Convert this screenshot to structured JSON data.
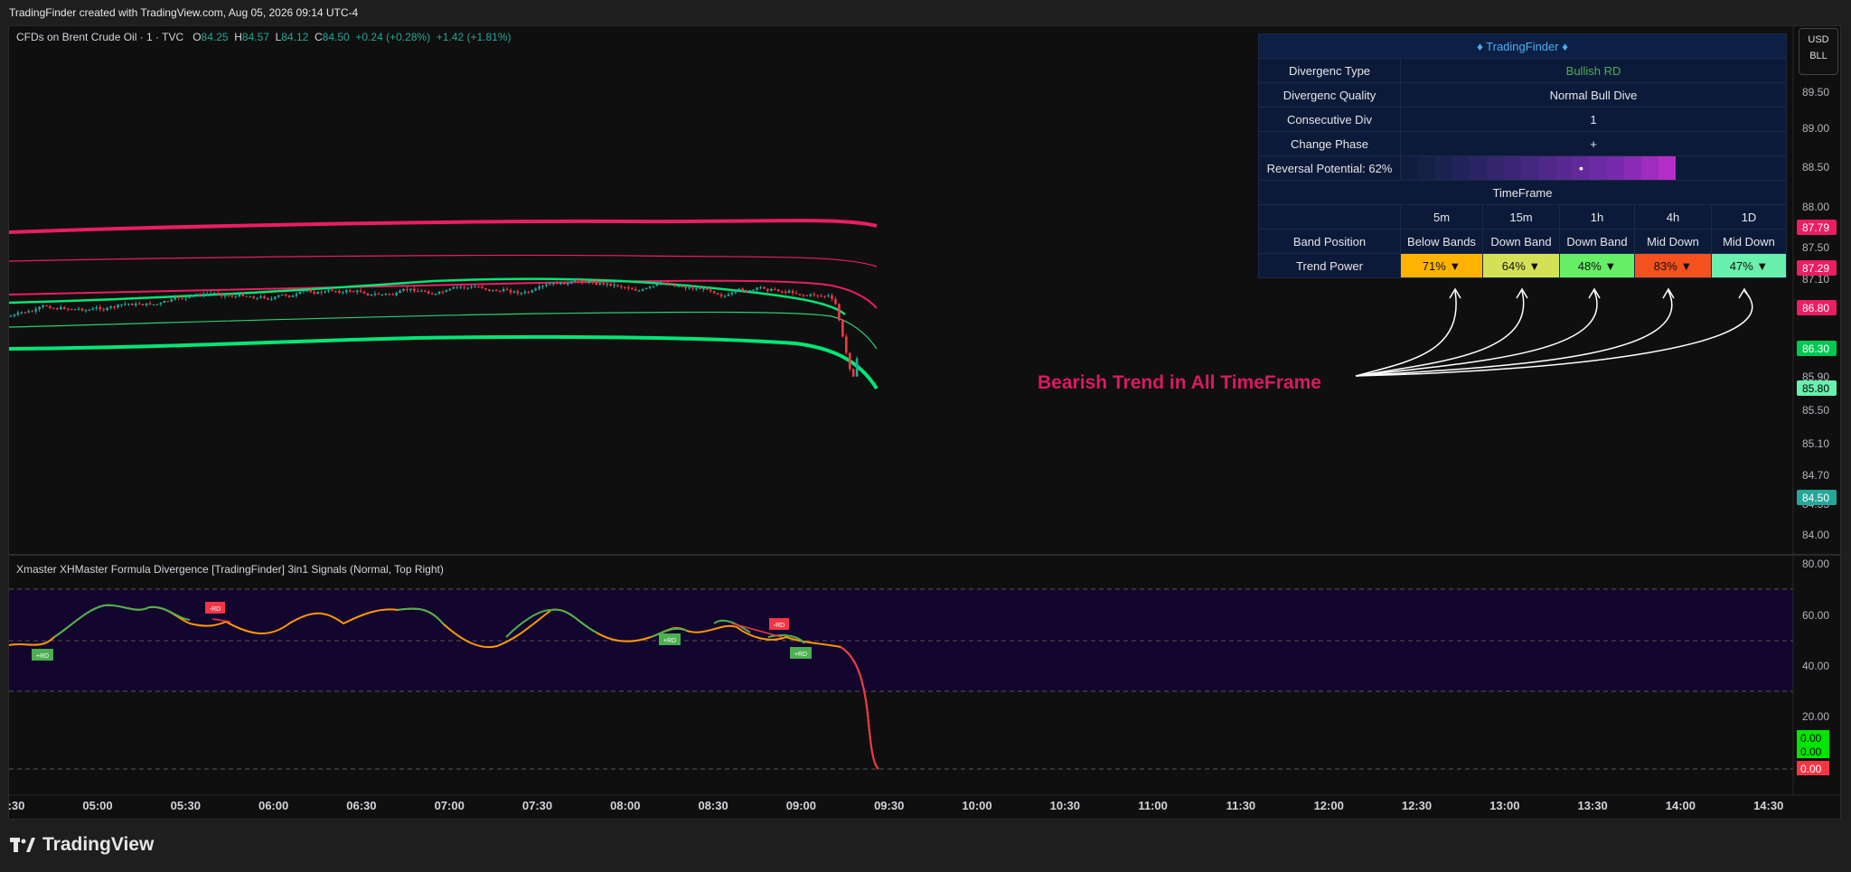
{
  "header": {
    "title": "TradingFinder created with TradingView.com, Aug 05, 2026 09:14 UTC-4"
  },
  "legend": {
    "symbol": "CFDs on Brent Crude Oil · 1 · TVC",
    "o_label": "O",
    "o": "84.25",
    "h_label": "H",
    "h": "84.57",
    "l_label": "L",
    "l": "84.12",
    "c_label": "C",
    "c": "84.50",
    "change": "+0.24 (+0.28%)",
    "change2": "+1.42 (+1.81%)"
  },
  "currency": {
    "line1": "USD",
    "line2": "BLL"
  },
  "price_axis": {
    "labels": [
      "89.50",
      "89.00",
      "88.50",
      "88.00",
      "87.50",
      "87.10",
      "85.90",
      "85.50",
      "85.10",
      "84.70",
      "84.35",
      "84.00"
    ],
    "tags": [
      {
        "text": "87.79",
        "color": "#e91e63"
      },
      {
        "text": "87.29",
        "color": "#e91e63"
      },
      {
        "text": "86.80",
        "color": "#e91e63"
      },
      {
        "text": "86.30",
        "color": "#00c853"
      },
      {
        "text": "85.80",
        "color": "#69f0ae"
      },
      {
        "text": "84.50",
        "color": "#26a69a"
      }
    ]
  },
  "osc_axis": {
    "labels": [
      "80.00",
      "60.00",
      "40.00",
      "20.00"
    ],
    "tags": [
      {
        "text": "0.00",
        "color": "#00e600"
      },
      {
        "text": "0.00",
        "color": "#00e600"
      },
      {
        "text": "0.00",
        "color": "#f23645"
      }
    ]
  },
  "time_axis": {
    "labels": [
      ":30",
      "05:00",
      "05:30",
      "06:00",
      "06:30",
      "07:00",
      "07:30",
      "08:00",
      "08:30",
      "09:00",
      "09:30",
      "10:00",
      "10:30",
      "11:00",
      "11:30",
      "12:00",
      "12:30",
      "13:00",
      "13:30",
      "14:00",
      "14:30"
    ]
  },
  "oscillator": {
    "title": "Xmaster XHMaster Formula Divergence [TradingFinder] 3in1 Signals (Normal, Top Right)",
    "signal_bull": "+RD",
    "signal_bear": "-RD"
  },
  "panel": {
    "title": "♦ TradingFinder ♦",
    "rows": [
      {
        "label": "Divergenc Type",
        "value": "Bullish RD"
      },
      {
        "label": "Divergenc Quality",
        "value": "Normal Bull Dive"
      },
      {
        "label": "Consecutive Div",
        "value": "1"
      },
      {
        "label": "Change Phase",
        "value": "+"
      }
    ],
    "reversal_label": "Reversal Potential: 62%",
    "reversal_marker": "•",
    "timeframe_label": "TimeFrame",
    "tfs": [
      "5m",
      "15m",
      "1h",
      "4h",
      "1D"
    ],
    "band_label": "Band Position",
    "bands": [
      "Below Bands",
      "Down Band",
      "Down Band",
      "Mid Down",
      "Mid Down"
    ],
    "power_label": "Trend Power",
    "powers": [
      "71% ▼",
      "64% ▼",
      "48% ▼",
      "83% ▼",
      "47% ▼"
    ],
    "power_colors": [
      "#ffb300",
      "#d4e157",
      "#66ee66",
      "#f4511e",
      "#69f0ae"
    ]
  },
  "annotation": "Bearish Trend in All TimeFrame",
  "brand": "TradingView"
}
